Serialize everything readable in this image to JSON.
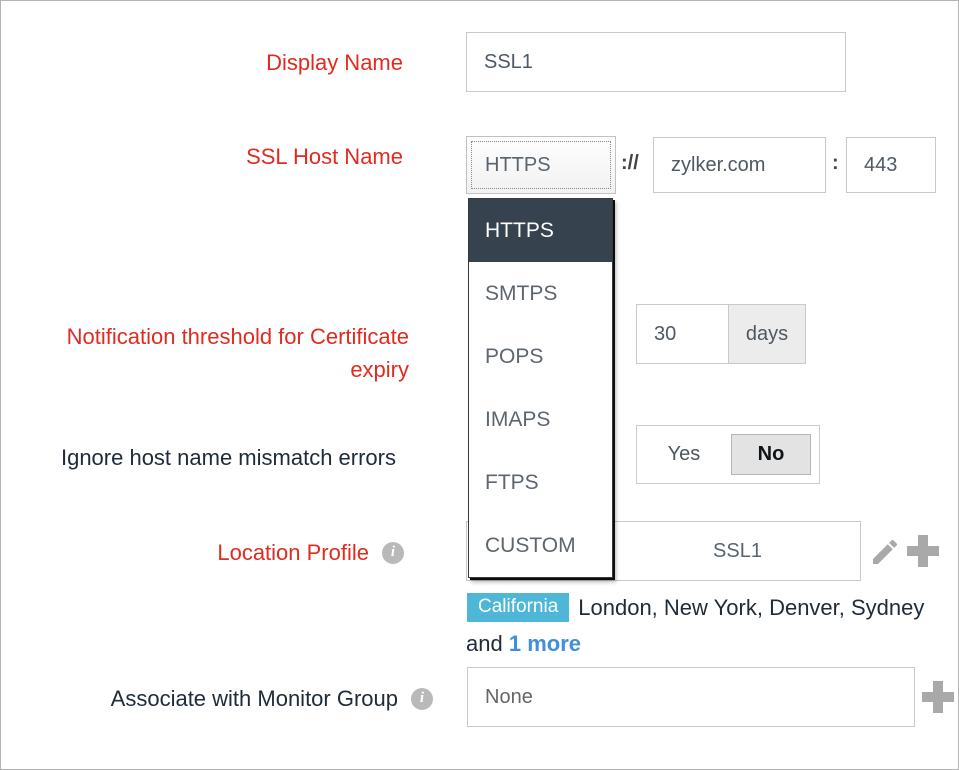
{
  "display_name": {
    "label": "Display Name",
    "value": "SSL1"
  },
  "ssl_host": {
    "label": "SSL Host Name",
    "protocol": "HTTPS",
    "sep1": "://",
    "host": "zylker.com",
    "sep2": ":",
    "port": "443",
    "options": [
      "HTTPS",
      "SMTPS",
      "POPS",
      "IMAPS",
      "FTPS",
      "CUSTOM"
    ],
    "selected_option": "HTTPS"
  },
  "threshold": {
    "label_line1": "Notification threshold for Certificate",
    "label_line2": "expiry",
    "value": "30",
    "unit": "days"
  },
  "ignore_mismatch": {
    "label": "Ignore host name mismatch errors",
    "yes": "Yes",
    "no": "No",
    "selected": "No"
  },
  "location_profile": {
    "label": "Location Profile",
    "value": "SSL1",
    "selected_badge": "California",
    "other_locations": "London, New York, Denver, Sydney",
    "conjunction": "and",
    "more_link": "1 more"
  },
  "monitor_group": {
    "label": "Associate with Monitor Group",
    "value": "None"
  },
  "icons": {
    "info": "i"
  },
  "colors": {
    "required_label": "#e02b20",
    "dropdown_selected_bg": "#36424e",
    "badge_blue": "#4eb7d8",
    "link_blue": "#3f90d8"
  }
}
